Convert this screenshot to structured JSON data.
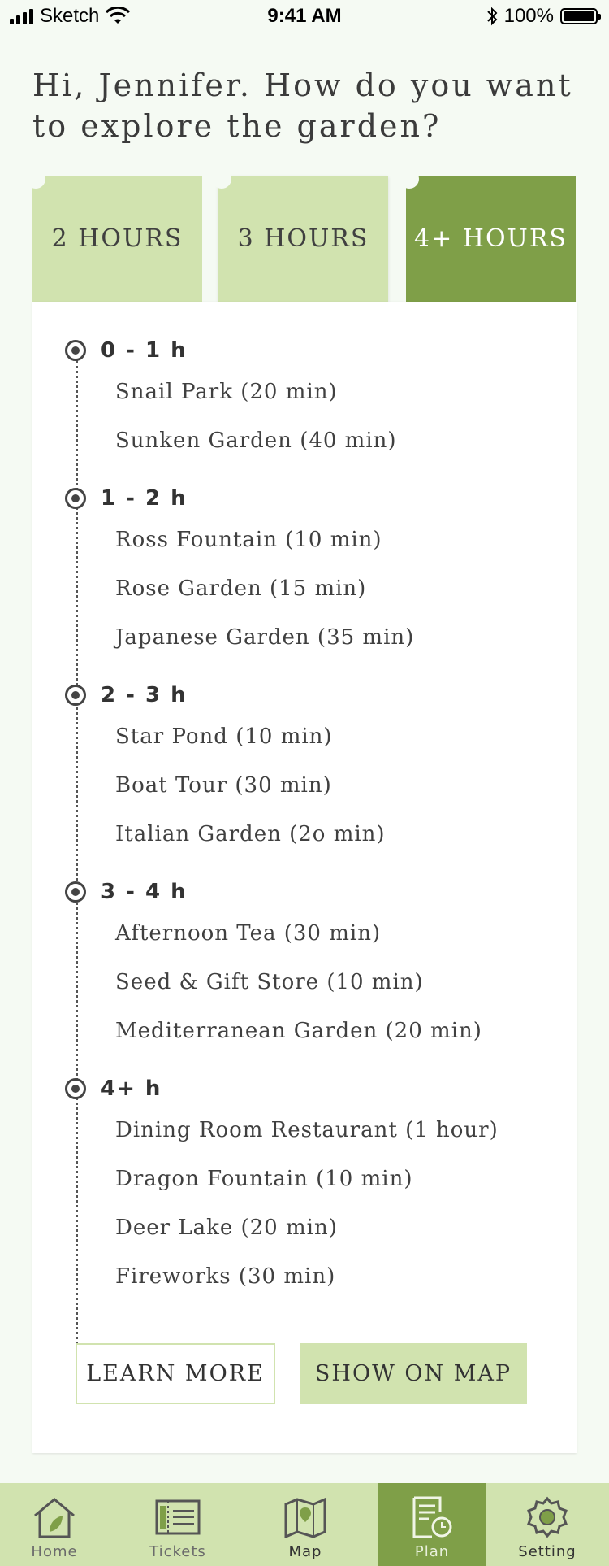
{
  "status": {
    "carrier": "Sketch",
    "time": "9:41 AM",
    "battery": "100%"
  },
  "greeting": "Hi, Jennifer. How do you want to explore the garden?",
  "tabs": [
    {
      "label": "2 HOURS",
      "selected": false
    },
    {
      "label": "3 HOURS",
      "selected": false
    },
    {
      "label": "4+ HOURS",
      "selected": true
    }
  ],
  "timeline": [
    {
      "label": "0 - 1 h",
      "items": [
        "Snail Park (20 min)",
        "Sunken Garden (40 min)"
      ]
    },
    {
      "label": "1 - 2 h",
      "items": [
        "Ross Fountain (10 min)",
        "Rose Garden (15 min)",
        "Japanese Garden (35 min)"
      ]
    },
    {
      "label": "2 - 3 h",
      "items": [
        "Star Pond (10 min)",
        "Boat Tour (30 min)",
        "Italian Garden (2o min)"
      ]
    },
    {
      "label": "3 - 4 h",
      "items": [
        "Afternoon Tea (30 min)",
        "Seed & Gift Store (10 min)",
        "Mediterranean Garden (20 min)"
      ]
    },
    {
      "label": "4+ h",
      "items": [
        "Dining Room Restaurant (1 hour)",
        "Dragon Fountain (10 min)",
        "Deer Lake (20 min)",
        "Fireworks (30 min)"
      ]
    }
  ],
  "buttons": {
    "learn_more": "LEARN MORE",
    "show_on_map": "SHOW ON MAP"
  },
  "nav": [
    {
      "label": "Home",
      "icon": "home-icon"
    },
    {
      "label": "Tickets",
      "icon": "ticket-icon"
    },
    {
      "label": "Map",
      "icon": "map-icon"
    },
    {
      "label": "Plan",
      "icon": "plan-icon",
      "active": true
    },
    {
      "label": "Setting",
      "icon": "settings-icon"
    }
  ],
  "colors": {
    "accent": "#7f9f48",
    "light": "#d1e3af",
    "background": "#f5faf3"
  }
}
